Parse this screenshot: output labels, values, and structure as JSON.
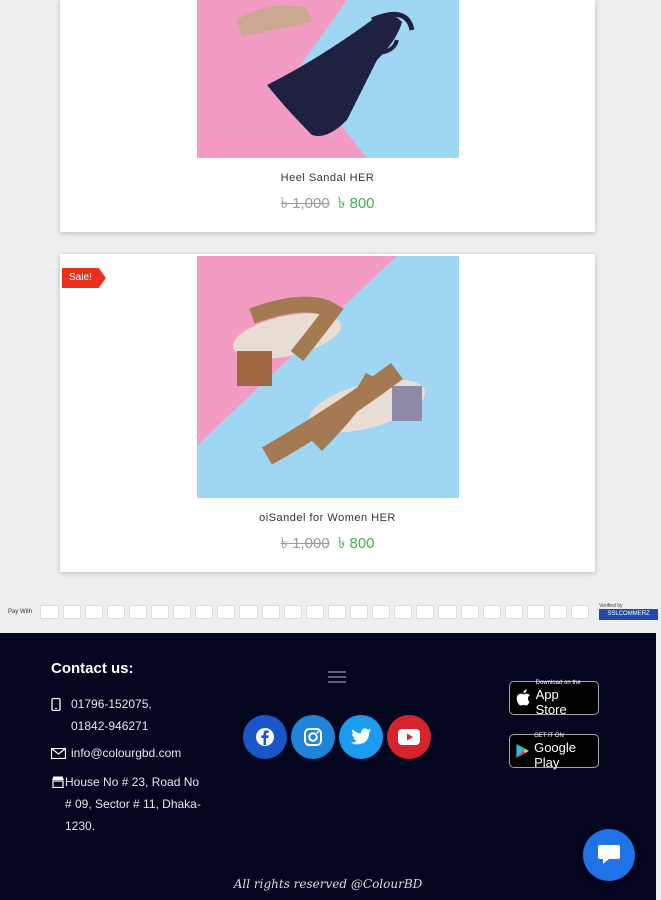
{
  "products": [
    {
      "name": "Heel Sandal HER",
      "old_price": "৳ 1,000",
      "new_price": "৳ 800",
      "sale": ""
    },
    {
      "name": "oiSandel for Women HER",
      "old_price": "৳ 1,000",
      "new_price": "৳ 800",
      "sale": "Sale!"
    }
  ],
  "payment": {
    "label": "Pay With",
    "verified_top": "Verified by",
    "verified_brand": "SSLCOMMERZ"
  },
  "footer": {
    "contact_title": "Contact us:",
    "phone1": "01796-152075,",
    "phone2": "01842-946271",
    "email": "info@colourgbd.com",
    "address": "House No # 23, Road No # 09, Sector # 11, Dhaka-1230."
  },
  "store_badges": {
    "app_small": "Download on the",
    "app_big": "App Store",
    "play_small": "GET IT ON",
    "play_big": "Google Play"
  },
  "copyright": "All rights reserved @ColourBD",
  "colors": {
    "accent_green": "#3cb54a",
    "sale_red": "#e8301c",
    "footer_bg": "#04051f",
    "chat_blue": "#1f72e8"
  }
}
